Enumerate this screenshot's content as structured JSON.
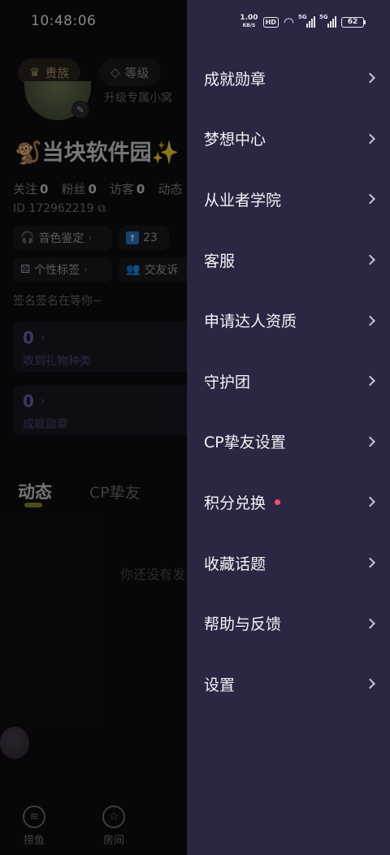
{
  "status_bar": {
    "time": "10:48:06",
    "net_speed_value": "1.00",
    "net_speed_unit": "KB/S",
    "hd_label": "HD",
    "signal1_label": "5G",
    "signal2_label": "5G",
    "battery": "62"
  },
  "profile": {
    "noble_label": "贵族",
    "level_label": "等级",
    "upgrade_hint": "升级专属小窝",
    "nickname": "🐒当块软件园✨",
    "stats": [
      {
        "label": "关注",
        "value": "0"
      },
      {
        "label": "粉丝",
        "value": "0"
      },
      {
        "label": "访客",
        "value": "0"
      },
      {
        "label": "动态",
        "value": ""
      }
    ],
    "user_id": "ID 172962219",
    "chips": {
      "voice": "音色鉴定",
      "rank_value": "23",
      "tags": "个性标签",
      "friend": "交友诉"
    },
    "signature": "签名签名在等你~",
    "cards": [
      {
        "value": "0",
        "label": "收到礼物种类"
      },
      {
        "value": "0",
        "label": "成就勋章"
      }
    ],
    "tabs": {
      "active": "动态",
      "other": "CP挚友"
    },
    "empty_text": "你还没有发",
    "bottom_nav": [
      {
        "label": "捞鱼",
        "icon": "voice-bubble-icon"
      },
      {
        "label": "房间",
        "icon": "star-room-icon"
      }
    ]
  },
  "drawer": {
    "menu_items": [
      {
        "label": "成就勋章",
        "badge": false
      },
      {
        "label": "梦想中心",
        "badge": false
      },
      {
        "label": "从业者学院",
        "badge": false
      },
      {
        "label": "客服",
        "badge": false
      },
      {
        "label": "申请达人资质",
        "badge": false
      },
      {
        "label": "守护团",
        "badge": false
      },
      {
        "label": "CP挚友设置",
        "badge": false
      },
      {
        "label": "积分兑换",
        "badge": true
      },
      {
        "label": "收藏话题",
        "badge": false
      },
      {
        "label": "帮助与反馈",
        "badge": false
      },
      {
        "label": "设置",
        "badge": false
      }
    ],
    "colors": {
      "background": "#2b2742",
      "badge_dot": "#ff4d6a"
    }
  }
}
